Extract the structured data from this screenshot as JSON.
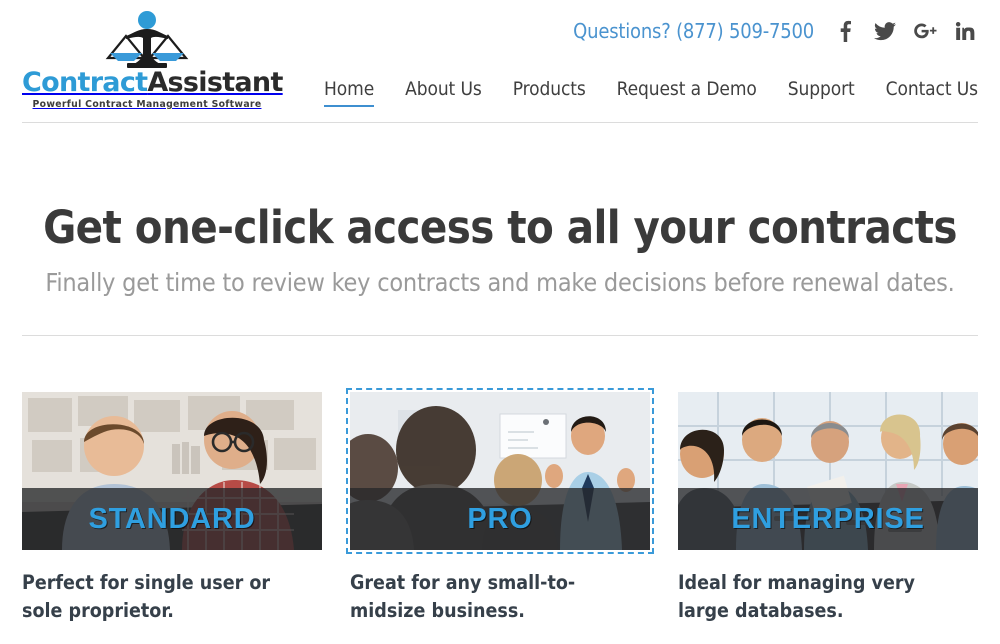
{
  "header": {
    "logo": {
      "icon": "scales-of-justice-icon",
      "word_primary": "Contract",
      "word_secondary": "Assistant",
      "tagline": "Powerful Contract Management Software",
      "primary_color": "#2e9bd6",
      "secondary_color": "#2b2b2b"
    },
    "contact": {
      "phone_label": "Questions? (877) 509-7500",
      "phone_color": "#4a93cf"
    },
    "social": [
      {
        "name": "facebook-icon",
        "label": "f"
      },
      {
        "name": "twitter-icon",
        "label": "Twitter"
      },
      {
        "name": "google-plus-icon",
        "label": "g+"
      },
      {
        "name": "linkedin-icon",
        "label": "in"
      }
    ],
    "nav": [
      {
        "label": "Home",
        "active": true
      },
      {
        "label": "About Us",
        "active": false
      },
      {
        "label": "Products",
        "active": false
      },
      {
        "label": "Request a Demo",
        "active": false
      },
      {
        "label": "Support",
        "active": false
      },
      {
        "label": "Contact Us",
        "active": false
      }
    ],
    "nav_active_color": "#3e8fd0"
  },
  "hero": {
    "title": "Get one-click access to all your contracts",
    "subtitle": "Finally get time to review key contracts and make decisions before renewal dates.",
    "title_color": "#3a3a3a",
    "subtitle_color": "#9a9a9a"
  },
  "plans": [
    {
      "label": "STANDARD",
      "caption": "Perfect for single user or sole proprietor.",
      "selected": false,
      "photo": "two-men-working-at-desk-photo"
    },
    {
      "label": "PRO",
      "caption": "Great for any small-to-midsize business.",
      "selected": true,
      "photo": "presenter-with-audience-photo"
    },
    {
      "label": "ENTERPRISE",
      "caption": "Ideal for managing very large databases.",
      "selected": false,
      "photo": "conference-room-meeting-photo"
    }
  ],
  "theme": {
    "label_color": "#2f9fe0",
    "band_color": "rgba(38,40,42,0.78)",
    "selection_border_color": "#3a9ad9",
    "divider_color": "#dcdcdc"
  }
}
